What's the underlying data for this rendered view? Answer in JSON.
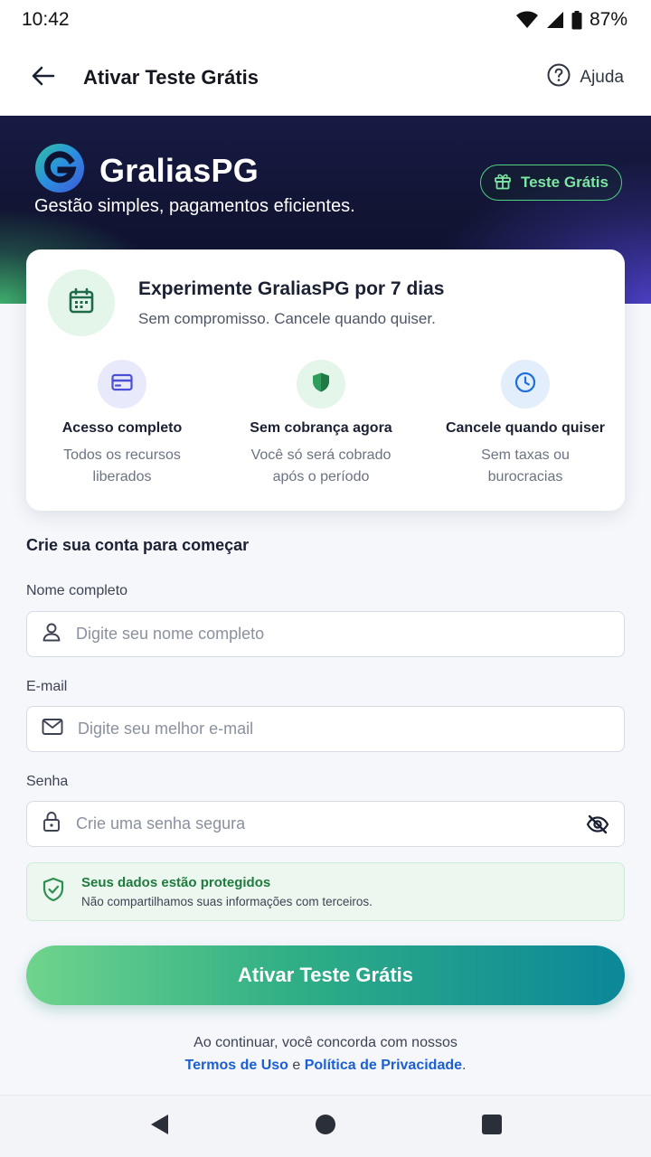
{
  "status_bar": {
    "time": "10:42",
    "battery": "87%",
    "icons": [
      "wifi-icon",
      "signal-icon",
      "battery-icon"
    ]
  },
  "app_bar": {
    "title": "Ativar Teste Grátis",
    "help_label": "Ajuda",
    "icons": [
      "back-arrow-icon",
      "help-circle-icon"
    ]
  },
  "hero": {
    "brand_name": "GraliasPG",
    "tagline": "Gestão simples, pagamentos eficientes.",
    "badge_label": "Teste Grátis",
    "colors": {
      "bg": "#111432",
      "accent_green": "#4fd083",
      "accent_purple": "#4a3fc2"
    }
  },
  "trial_card": {
    "title": "Experimente GraliasPG por 7 dias",
    "subtitle": "Sem compromisso. Cancele quando quiser.",
    "features": [
      {
        "icon": "credit-card-icon",
        "title": "Acesso completo",
        "desc": "Todos os recursos liberados"
      },
      {
        "icon": "shield-icon",
        "title": "Sem cobrança agora",
        "desc": "Você só será cobrado após o período"
      },
      {
        "icon": "clock-icon",
        "title": "Cancele quando quiser",
        "desc": "Sem taxas ou burocracias"
      }
    ]
  },
  "form": {
    "heading": "Crie sua conta para começar",
    "name": {
      "label": "Nome completo",
      "placeholder": "Digite seu nome completo",
      "value": ""
    },
    "email": {
      "label": "E-mail",
      "placeholder": "Digite seu melhor e-mail",
      "value": ""
    },
    "password": {
      "label": "Senha",
      "placeholder": "Crie uma senha segura",
      "value": ""
    }
  },
  "protection": {
    "title": "Seus dados estão protegidos",
    "subtitle": "Não compartilhamos suas informações com terceiros."
  },
  "cta": {
    "label": "Ativar Teste Grátis"
  },
  "terms": {
    "prefix": "Ao continuar, você concorda com nossos",
    "terms_link": "Termos de Uso",
    "connector": " e ",
    "privacy_link": "Política de Privacidade",
    "suffix": "."
  },
  "nav_bar": {
    "icons": [
      "nav-back-icon",
      "nav-home-icon",
      "nav-recents-icon"
    ]
  }
}
